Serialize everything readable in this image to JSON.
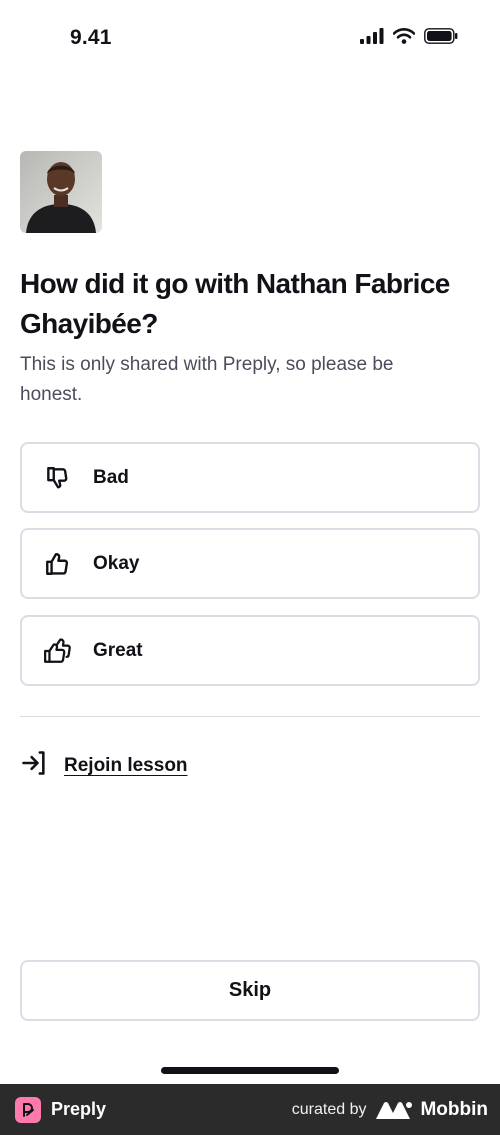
{
  "status_bar": {
    "time": "9.41"
  },
  "feedback": {
    "title": "How did it go with Nathan Fabrice Ghayibée?",
    "subtitle": "This is only shared with Preply, so please be honest.",
    "options": [
      {
        "label": "Bad",
        "icon": "thumbs-down-icon"
      },
      {
        "label": "Okay",
        "icon": "thumbs-up-icon"
      },
      {
        "label": "Great",
        "icon": "double-thumbs-up-icon"
      }
    ],
    "rejoin_label": "Rejoin lesson",
    "skip_label": "Skip"
  },
  "footer": {
    "app_name": "Preply",
    "curated_by": "curated by",
    "curator": "Mobbin"
  },
  "colors": {
    "text": "#121117",
    "muted_text": "#4d4c5c",
    "border": "#dcdce5",
    "footer_bg": "#2b2b2b",
    "preply_pink": "#ff7aac"
  }
}
